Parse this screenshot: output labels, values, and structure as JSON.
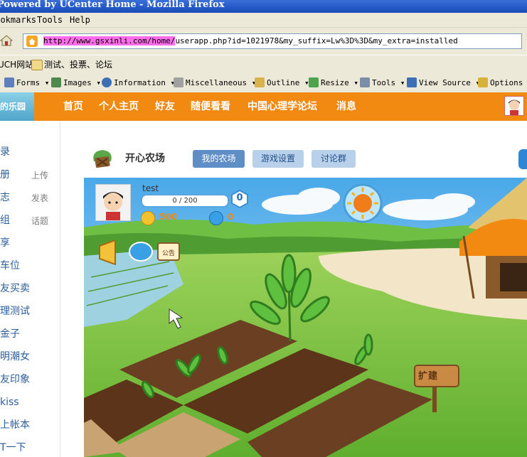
{
  "window": {
    "title": "Powered by UCenter Home - Mozilla Firefox"
  },
  "menu": {
    "bookmarks": "Bookmarks",
    "tools": "Tools",
    "help": "Help"
  },
  "address": {
    "highlighted": "http://www.gsxinli.com/home/",
    "rest": "userapp.php?id=1021978&my_suffix=Lw%3D%3D&my_extra=installed"
  },
  "bookmarks_bar": {
    "item1": "UCH网站",
    "item2": "测试、投票、论坛"
  },
  "devtools": {
    "forms": "Forms",
    "images": "Images",
    "information": "Information",
    "misc": "Miscellaneous",
    "outline": "Outline",
    "resize": "Resize",
    "tools": "Tools",
    "view_source": "View Source",
    "options": "Options"
  },
  "site": {
    "logo_text": "我的乐园",
    "nav": [
      "首页",
      "个人主页",
      "好友",
      "随便看看",
      "中国心理学论坛",
      "消息"
    ]
  },
  "sidebar": {
    "items": [
      "录",
      "册",
      "志",
      "组",
      "享",
      "车位",
      "友买卖",
      "理测试",
      "金子",
      "明潮女",
      "友印象",
      "kiss",
      "上帐本",
      "T一下"
    ],
    "right": [
      "上传",
      "发表",
      "话题"
    ]
  },
  "farm": {
    "title": "开心农场",
    "tabs": {
      "myfarm": "我的农场",
      "settings": "游戏设置",
      "discuss": "讨论群"
    }
  },
  "hud": {
    "username": "test",
    "exp_text": "0 / 200",
    "exp_fraction": 0,
    "level": "0",
    "coins": "500",
    "gems": "0",
    "notice_label": "公告",
    "sign_label": "扩建"
  },
  "colors": {
    "nav_orange": "#f28a12",
    "tab_active": "#5f8ec6",
    "tab_inactive": "#b9d0ea",
    "address_highlight": "#ff6ee8"
  }
}
